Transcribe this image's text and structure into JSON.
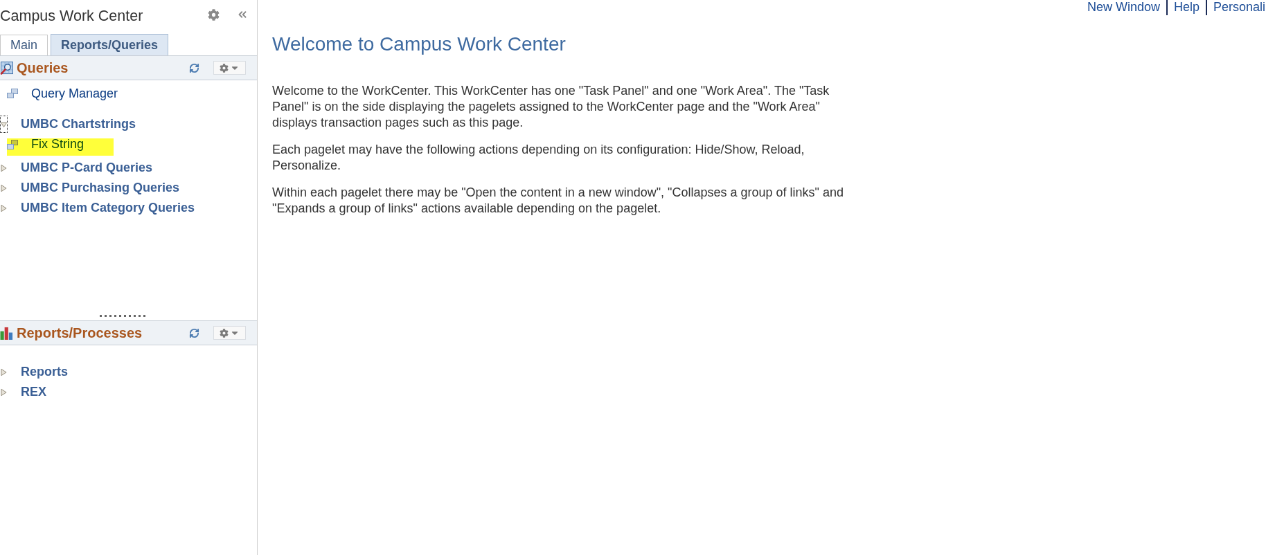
{
  "task_panel": {
    "title": "Campus Work Center",
    "tabs": [
      {
        "label": "Main",
        "selected": false
      },
      {
        "label": "Reports/Queries",
        "selected": true
      }
    ],
    "pagelets": [
      {
        "title": "Queries",
        "items": [
          {
            "kind": "link",
            "label": "Query Manager",
            "highlighted": false
          },
          {
            "kind": "folder",
            "label": "UMBC Chartstrings",
            "expanded": true,
            "focused": true,
            "children": [
              {
                "kind": "link",
                "label": "Fix String",
                "highlighted": true
              }
            ]
          },
          {
            "kind": "folder",
            "label": "UMBC P-Card Queries",
            "expanded": false,
            "focused": false
          },
          {
            "kind": "folder",
            "label": "UMBC Purchasing Queries",
            "expanded": false,
            "focused": false
          },
          {
            "kind": "folder",
            "label": "UMBC Item Category Queries",
            "expanded": false,
            "focused": false
          }
        ]
      },
      {
        "title": "Reports/Processes",
        "items": [
          {
            "kind": "folder",
            "label": "Reports",
            "expanded": false,
            "focused": false
          },
          {
            "kind": "folder",
            "label": "REX",
            "expanded": false,
            "focused": false
          }
        ]
      }
    ]
  },
  "header_links": [
    "New Window",
    "Help",
    "Personali"
  ],
  "work_area": {
    "title": "Welcome to Campus Work Center",
    "paragraphs": [
      "Welcome to the WorkCenter. This WorkCenter has one \"Task Panel\" and one \"Work Area\". The \"Task Panel\" is on the side displaying the pagelets assigned to the WorkCenter page and the \"Work Area\" displays transaction pages such as this page.",
      "Each pagelet may have the following actions depending on its configuration: Hide/Show, Reload, Personalize.",
      "Within each pagelet there may be \"Open the content in a new window\", \"Collapses a group of links\" and \"Expands a group of links\" actions available depending on the pagelet."
    ]
  }
}
